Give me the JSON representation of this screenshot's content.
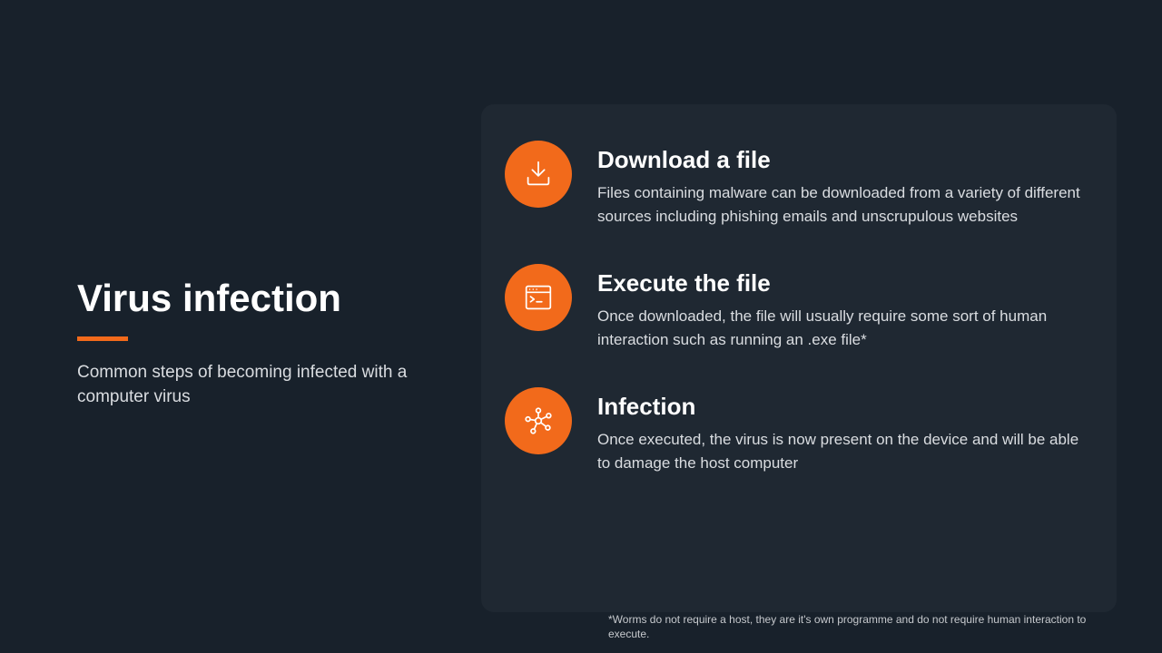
{
  "left": {
    "title": "Virus infection",
    "subtitle": "Common steps of becoming infected with a computer virus"
  },
  "steps": [
    {
      "title": "Download a file",
      "desc": "Files containing malware can be downloaded from a variety of different sources including phishing emails and unscrupulous websites"
    },
    {
      "title": "Execute the file",
      "desc": "Once downloaded, the file will usually require some sort of human interaction such as running an .exe file*"
    },
    {
      "title": "Infection",
      "desc": "Once executed, the virus is now present on the device and will be able to damage the host computer"
    }
  ],
  "footnote": "*Worms do not require a host, they are it's own programme and do not require human interaction to execute."
}
